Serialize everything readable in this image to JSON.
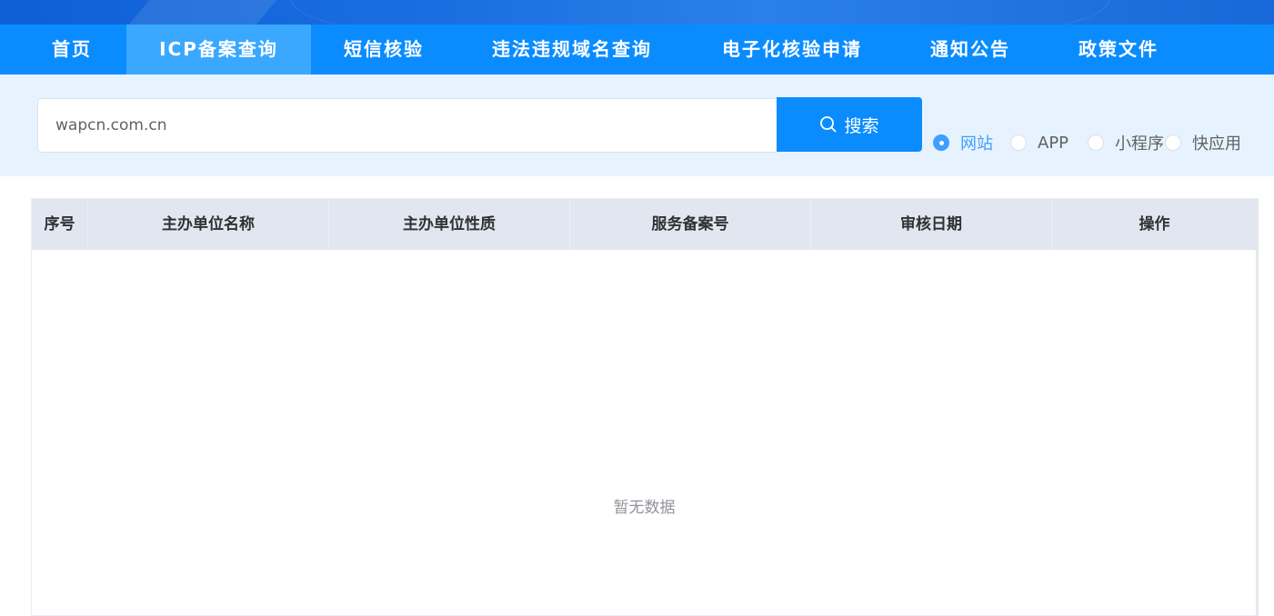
{
  "nav": {
    "items": [
      {
        "label": "首页"
      },
      {
        "label": "ICP备案查询",
        "active": true
      },
      {
        "label": "短信核验"
      },
      {
        "label": "违法违规域名查询"
      },
      {
        "label": "电子化核验申请"
      },
      {
        "label": "通知公告"
      },
      {
        "label": "政策文件"
      }
    ]
  },
  "search": {
    "value": "wapcn.com.cn",
    "button_label": "搜索",
    "button_icon": "search-icon",
    "types": [
      {
        "label": "网站",
        "checked": true
      },
      {
        "label": "APP",
        "checked": false
      },
      {
        "label": "小程序",
        "checked": false
      },
      {
        "label": "快应用",
        "checked": false
      }
    ]
  },
  "table": {
    "columns": [
      "序号",
      "主办单位名称",
      "主办单位性质",
      "服务备案号",
      "审核日期",
      "操作"
    ],
    "rows": [],
    "empty_text": "暂无数据"
  },
  "colors": {
    "nav_bg": "#0a8cff",
    "nav_active_bg": "#3aa8ff",
    "search_band_bg": "#e6f3fe",
    "radio_checked": "#409eff",
    "table_header_bg": "#e1e6f0"
  }
}
